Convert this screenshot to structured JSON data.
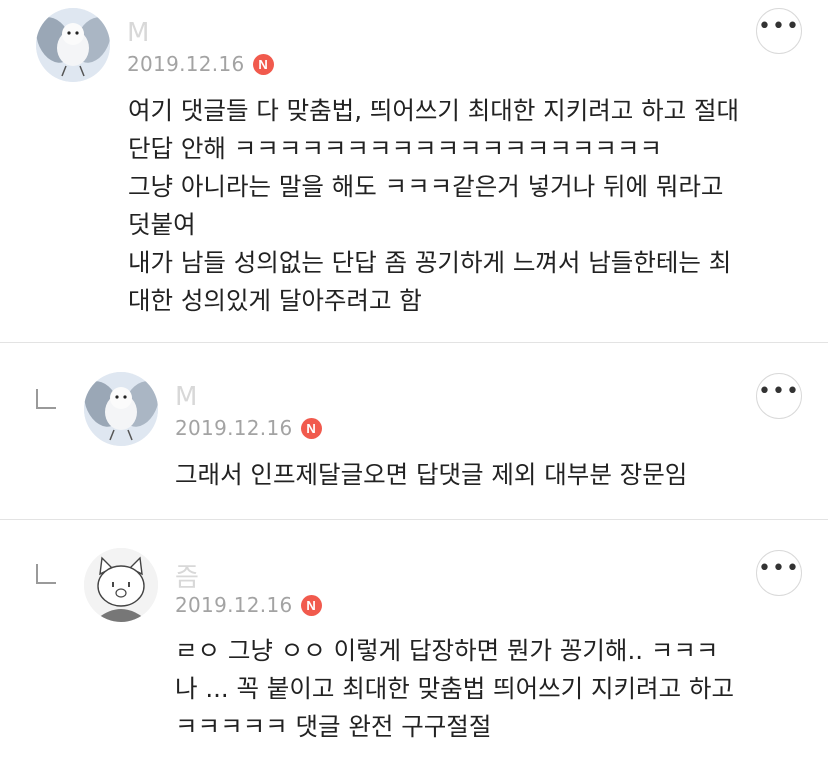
{
  "comments": [
    {
      "author": "M",
      "date": "2019.12.16",
      "badge": "N",
      "more_label": "•••",
      "lines": [
        "여기 댓글들 다 맞춤법, 띄어쓰기 최대한 지키려고 하고 절대",
        "단답 안해 ㅋㅋㅋㅋㅋㅋㅋㅋㅋㅋㅋㅋㅋㅋㅋㅋㅋㅋㅋ",
        "그냥 아니라는 말을 해도 ㅋㅋㅋ같은거 넣거나 뒤에 뭐라고",
        "덧붙여",
        "내가 남들 성의없는 단답 좀 꽁기하게 느껴서 남들한테는 최",
        "대한 성의있게 달아주려고 함"
      ]
    },
    {
      "author": "M",
      "date": "2019.12.16",
      "badge": "N",
      "more_label": "•••",
      "lines": [
        "그래서 인프제달글오면 답댓글 제외 대부분 장문임"
      ]
    },
    {
      "author": "즘",
      "date": "2019.12.16",
      "badge": "N",
      "more_label": "•••",
      "lines": [
        "ㄹㅇ 그냥 ㅇㅇ 이렇게 답장하면 뭔가 꽁기해.. ㅋㅋㅋ",
        "나 ... 꼭 붙이고 최대한 맞춤법 띄어쓰기 지키려고 하고",
        "ㅋㅋㅋㅋㅋ 댓글 완전 구구절절"
      ]
    }
  ]
}
